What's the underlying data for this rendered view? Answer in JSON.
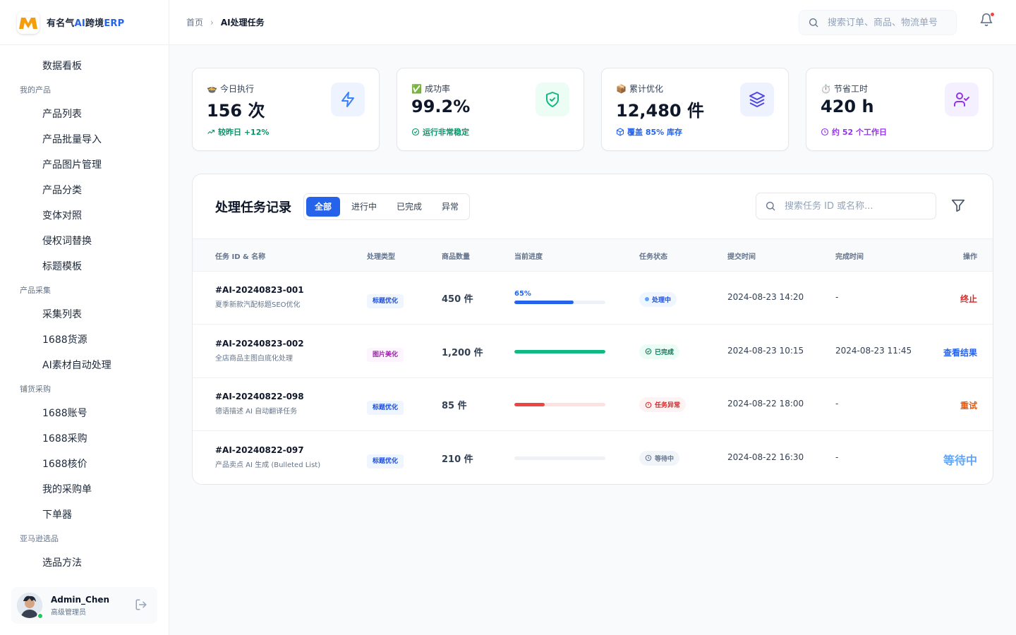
{
  "brand": {
    "name_prefix": "有名气",
    "name_ai": "AI",
    "name_mid": "跨境",
    "name_erp": "ERP"
  },
  "sidebar": {
    "top_item": "数据看板",
    "groups": [
      {
        "label": "我的产品",
        "items": [
          "产品列表",
          "产品批量导入",
          "产品图片管理",
          "产品分类",
          "变体对照",
          "侵权词替换",
          "标题模板"
        ]
      },
      {
        "label": "产品采集",
        "items": [
          "采集列表",
          "1688货源",
          "AI素材自动处理"
        ]
      },
      {
        "label": "铺货采购",
        "items": [
          "1688账号",
          "1688采购",
          "1688核价",
          "我的采购单",
          "下单器"
        ]
      },
      {
        "label": "亚马逊选品",
        "items": [
          "选品方法"
        ]
      }
    ]
  },
  "user": {
    "name": "Admin_Chen",
    "role": "高级管理员"
  },
  "header": {
    "breadcrumb_home": "首页",
    "breadcrumb_current": "AI处理任务",
    "search_placeholder": "搜索订单、商品、物流单号"
  },
  "stats": [
    {
      "emoji": "🍲",
      "label": "今日执行",
      "value": "156 次",
      "note": "较昨日 +12%",
      "note_color": "#059669",
      "icon": "lightning-icon",
      "icon_bg": "#eef4ff",
      "icon_color": "#3b82f6"
    },
    {
      "emoji": "✅",
      "label": "成功率",
      "value": "99.2%",
      "note": "运行非常稳定",
      "note_color": "#059669",
      "icon": "shield-check-icon",
      "icon_bg": "#ecfdf5",
      "icon_color": "#10b981"
    },
    {
      "emoji": "📦",
      "label": "累计优化",
      "value": "12,480 件",
      "note": "覆盖 85% 库存",
      "note_color": "#2563eb",
      "icon": "layers-icon",
      "icon_bg": "#eef2ff",
      "icon_color": "#4f46e5"
    },
    {
      "emoji": "⏱️",
      "label": "节省工时",
      "value": "420 h",
      "note": "约 52 个工作日",
      "note_color": "#9333ea",
      "icon": "user-check-icon",
      "icon_bg": "#f5f0ff",
      "icon_color": "#9333ea"
    }
  ],
  "tasks": {
    "title": "处理任务记录",
    "tabs": [
      "全部",
      "进行中",
      "已完成",
      "异常"
    ],
    "search_placeholder": "搜索任务 ID 或名称...",
    "columns": [
      "任务 ID & 名称",
      "处理类型",
      "商品数量",
      "当前进度",
      "任务状态",
      "提交时间",
      "完成时间",
      "操作"
    ],
    "rows": [
      {
        "id": "#AI-20240823-001",
        "name": "夏季新款汽配标题SEO优化",
        "type": "标题优化",
        "type_bg": "#eff6ff",
        "type_color": "#1d4ed8",
        "qty": "450 件",
        "progress": 0.65,
        "progress_label": "65%",
        "bar_color": "#2563eb",
        "track_color": "#eef2f7",
        "status": "处理中",
        "status_bg": "#eff6ff",
        "status_color": "#1d4ed8",
        "submitted": "2024-08-23 14:20",
        "finished": "-",
        "action": "终止",
        "action_color": "#dc2626"
      },
      {
        "id": "#AI-20240823-002",
        "name": "全店商品主图白底化处理",
        "type": "图片美化",
        "type_bg": "#fdf4ff",
        "type_color": "#a21caf",
        "qty": "1,200 件",
        "progress": 1.0,
        "progress_label": "",
        "bar_color": "#10b981",
        "track_color": "#eef2f7",
        "status": "已完成",
        "status_bg": "#ecfdf5",
        "status_color": "#047857",
        "submitted": "2024-08-23 10:15",
        "finished": "2024-08-23 11:45",
        "action": "查看结果",
        "action_color": "#2563eb"
      },
      {
        "id": "#AI-20240822-098",
        "name": "德语描述 AI 自动翻译任务",
        "type": "标题优化",
        "type_bg": "#eff6ff",
        "type_color": "#1d4ed8",
        "qty": "85 件",
        "progress": 0.33,
        "progress_label": "",
        "bar_color": "#ef4444",
        "track_color": "#fee2e2",
        "status": "任务异常",
        "status_bg": "#fef2f2",
        "status_color": "#dc2626",
        "submitted": "2024-08-22 18:00",
        "finished": "-",
        "action": "重试",
        "action_color": "#ea580c"
      },
      {
        "id": "#AI-20240822-097",
        "name": "产品卖点 AI 生成 (Bulleted List)",
        "type": "标题优化",
        "type_bg": "#eff6ff",
        "type_color": "#1d4ed8",
        "qty": "210 件",
        "progress": 0.0,
        "progress_label": "",
        "bar_color": "#94a3b8",
        "track_color": "#eef2f7",
        "status": "等待中",
        "status_bg": "#f1f5f9",
        "status_color": "#64748b",
        "submitted": "2024-08-22 16:30",
        "finished": "-",
        "action": "等待中",
        "action_color": "#60a5fa"
      }
    ]
  }
}
